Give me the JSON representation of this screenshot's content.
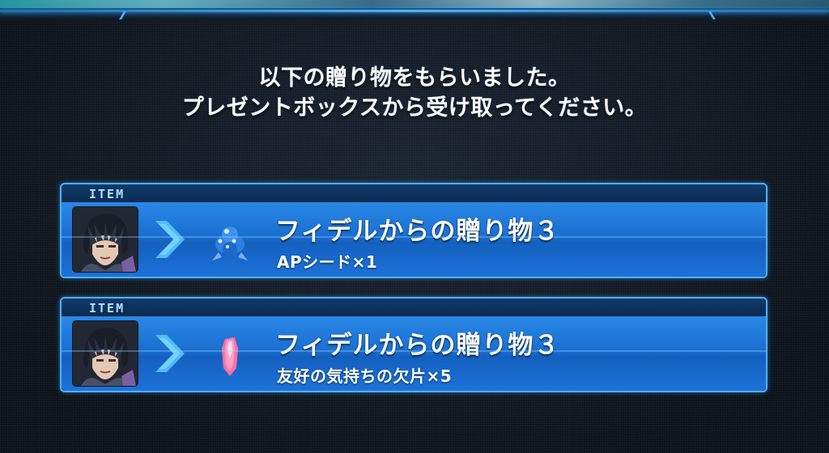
{
  "message": {
    "line1": "以下の贈り物をもらいました。",
    "line2": "プレゼントボックスから受け取ってください。"
  },
  "items": [
    {
      "tag": "ITEM",
      "title": "フィデルからの贈り物３",
      "reward": "APシード×1",
      "icon": "ap-seed-icon"
    },
    {
      "tag": "ITEM",
      "title": "フィデルからの贈り物３",
      "reward": "友好の気持ちの欠片×5",
      "icon": "friendship-fragment-icon"
    }
  ],
  "colors": {
    "accent": "#4fb0ff",
    "card_fill": "#1d72d8",
    "background": "#0f1620"
  }
}
